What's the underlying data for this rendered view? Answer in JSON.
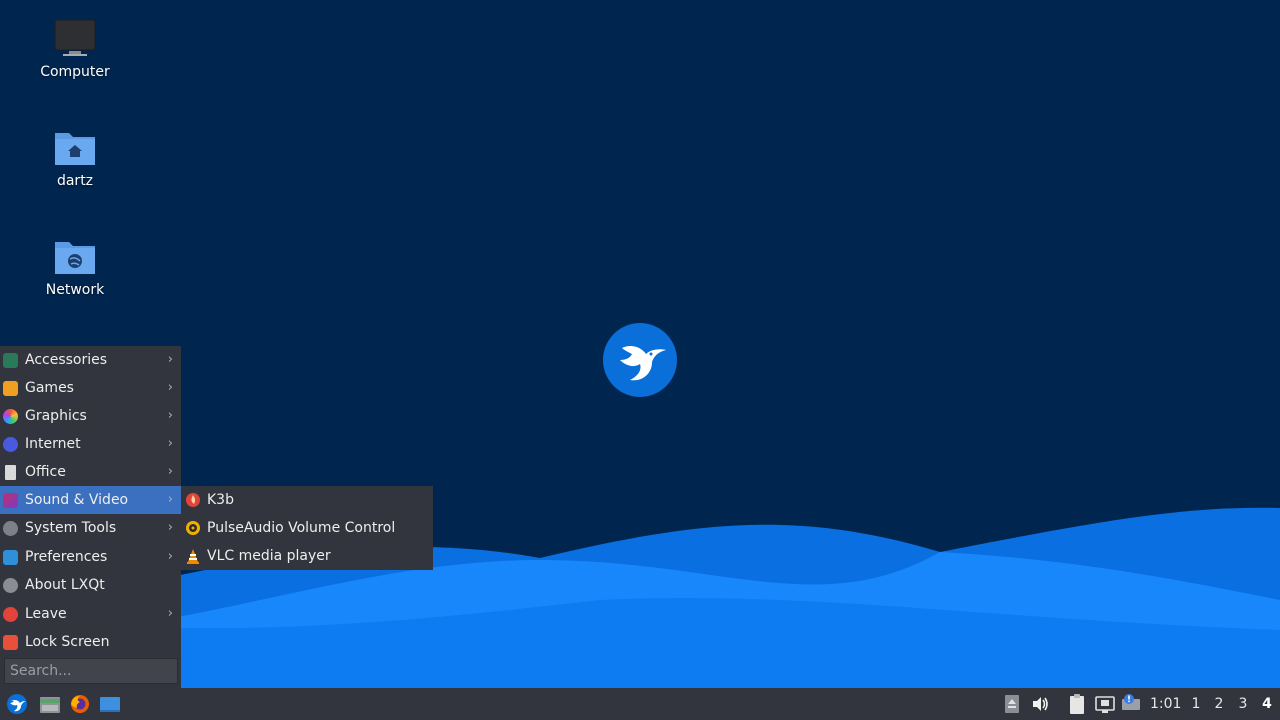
{
  "desktop": {
    "icons": [
      {
        "label": "Computer",
        "icon": "computer-icon"
      },
      {
        "label": "dartz",
        "icon": "home-folder-icon"
      },
      {
        "label": "Network",
        "icon": "network-folder-icon"
      }
    ],
    "wallpaper_colors": {
      "background": "#002650",
      "wave_light": "#1a8cff",
      "wave_dark": "#0a6fe0"
    }
  },
  "start_menu": {
    "items": [
      {
        "label": "Accessories",
        "icon": "accessories-icon",
        "has_submenu": true
      },
      {
        "label": "Games",
        "icon": "games-icon",
        "has_submenu": true
      },
      {
        "label": "Graphics",
        "icon": "graphics-icon",
        "has_submenu": true
      },
      {
        "label": "Internet",
        "icon": "internet-icon",
        "has_submenu": true
      },
      {
        "label": "Office",
        "icon": "office-icon",
        "has_submenu": true
      },
      {
        "label": "Sound & Video",
        "icon": "sound-video-icon",
        "has_submenu": true,
        "active": true
      },
      {
        "label": "System Tools",
        "icon": "system-tools-icon",
        "has_submenu": true
      },
      {
        "label": "Preferences",
        "icon": "preferences-icon",
        "has_submenu": true
      },
      {
        "label": "About LXQt",
        "icon": "info-icon",
        "has_submenu": false
      },
      {
        "label": "Leave",
        "icon": "power-icon",
        "has_submenu": true
      },
      {
        "label": "Lock Screen",
        "icon": "lock-icon",
        "has_submenu": false
      }
    ],
    "arrow": "›",
    "search_placeholder": "Search...",
    "highlight_color": "#3b6fbf"
  },
  "submenu": {
    "items": [
      {
        "label": "K3b",
        "icon": "k3b-icon"
      },
      {
        "label": "PulseAudio Volume Control",
        "icon": "pulseaudio-icon"
      },
      {
        "label": "VLC media player",
        "icon": "vlc-icon"
      }
    ]
  },
  "taskbar": {
    "launchers": [
      "start-menu-icon",
      "file-manager-icon",
      "firefox-icon",
      "show-desktop-icon"
    ],
    "tray_icons": [
      "eject-icon",
      "volume-icon",
      "clipboard-icon",
      "network-icon",
      "update-notification-icon"
    ],
    "clock": "1:01",
    "desktops": [
      "1",
      "2",
      "3",
      "4"
    ],
    "current_desktop": "4"
  }
}
